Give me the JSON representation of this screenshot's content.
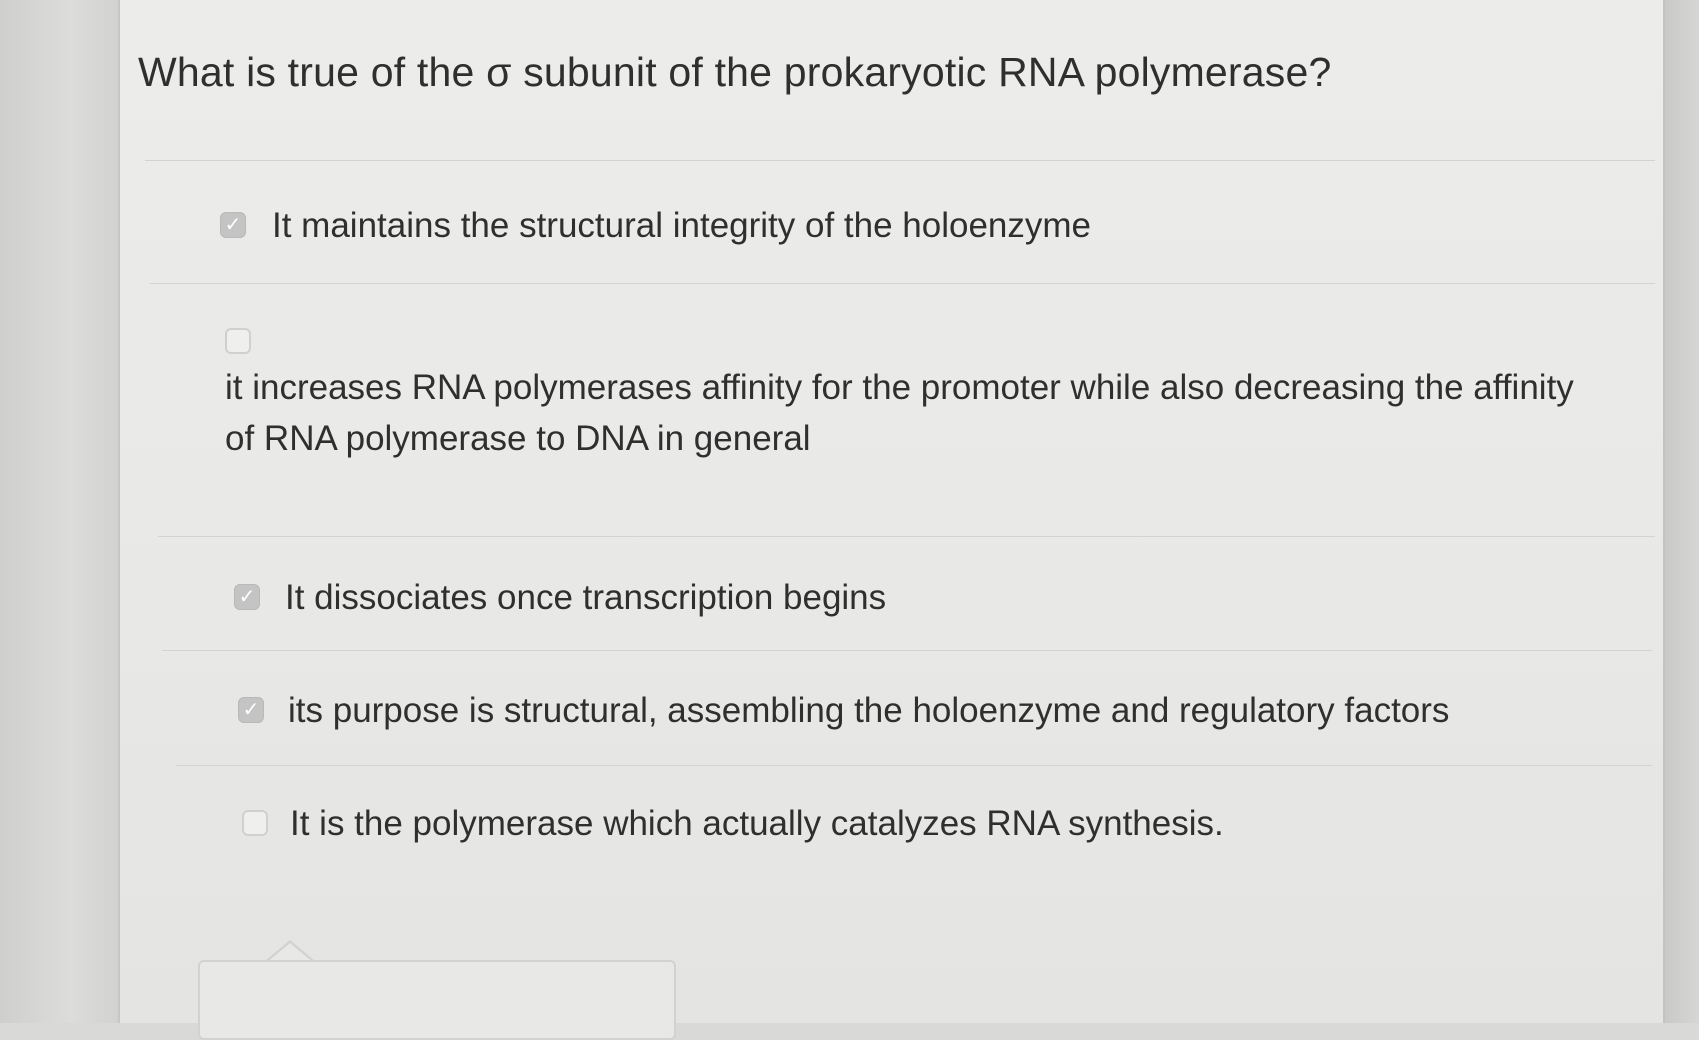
{
  "question": {
    "text": "What is true of the σ subunit of the prokaryotic RNA polymerase?"
  },
  "options": [
    {
      "checked": true,
      "text": "It maintains the structural integrity of the holoenzyme"
    },
    {
      "checked": false,
      "text": "it increases RNA polymerases affinity for the promoter while also decreasing the affinity of RNA polymerase to DNA in general"
    },
    {
      "checked": true,
      "text": "It dissociates once transcription begins"
    },
    {
      "checked": true,
      "text": "its purpose is structural, assembling the holoenzyme and regulatory factors"
    },
    {
      "checked": false,
      "text": "It is the polymerase which actually catalyzes RNA synthesis."
    }
  ],
  "colors": {
    "background": "#e9e9e7",
    "checkbox_checked": "#c3c4c3",
    "text": "#2f2f2f"
  },
  "icons": {
    "checked": "checkmark-icon"
  }
}
